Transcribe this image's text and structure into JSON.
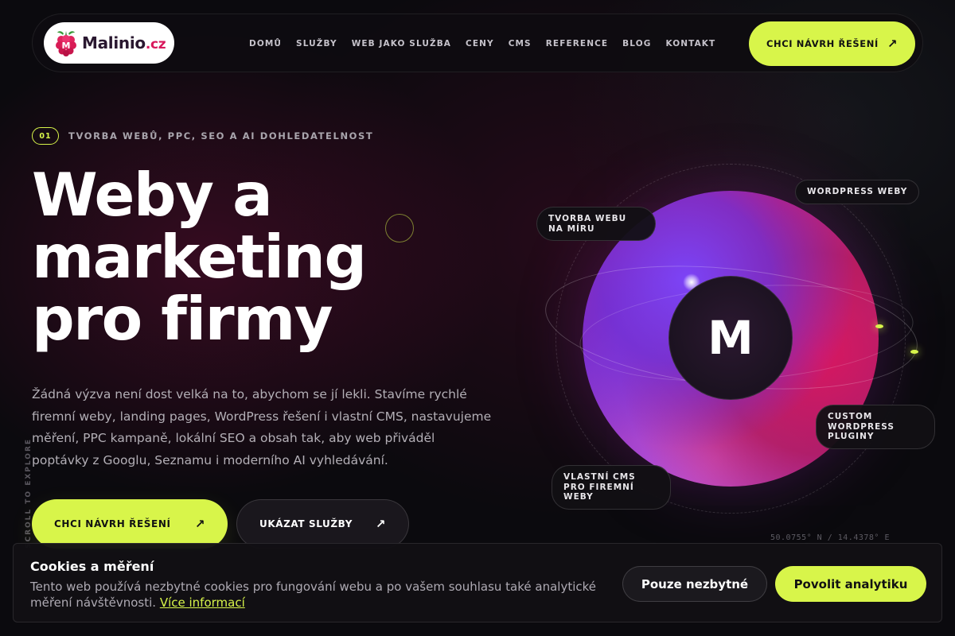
{
  "brand": {
    "name": "Malinio",
    "tld": ".cz",
    "accent": "#d8f54a",
    "logo_icon": "raspberry-icon"
  },
  "nav": {
    "items": [
      "DOMŮ",
      "SLUŽBY",
      "WEB JAKO SLUŽBA",
      "CENY",
      "CMS",
      "REFERENCE",
      "BLOG",
      "KONTAKT"
    ],
    "cta_label": "CHCI NÁVRH ŘEŠENÍ",
    "cta_icon": "arrow-up-right-icon"
  },
  "hero": {
    "eyebrow_number": "01",
    "eyebrow_text": "TVORBA WEBŮ, PPC, SEO A AI DOHLEDATELNOST",
    "title_lines": [
      "Weby a",
      "marketing",
      "pro firmy"
    ],
    "description": "Žádná výzva není dost velká na to, abychom se jí lekli. Stavíme rychlé firemní weby, landing pages, WordPress řešení i vlastní CMS, nastavujeme měření, PPC kampaně, lokální SEO a obsah tak, aby web přiváděl poptávky z Googlu, Seznamu i moderního AI vyhledávání.",
    "primary_button": "CHCI NÁVRH ŘEŠENÍ",
    "secondary_button": "UKÁZAT SLUŽBY",
    "scroll_label": "SCROLL TO EXPLORE"
  },
  "orb": {
    "core_letter": "M",
    "chips": {
      "custom_web": "TVORBA WEBU NA MÍRU",
      "wordpress": "WORDPRESS WEBY",
      "plugins": "CUSTOM WORDPRESS PLUGINY",
      "cms": "VLASTNÍ CMS PRO FIREMNÍ WEBY"
    },
    "coordinates": "50.0755° N / 14.4378° E"
  },
  "cookie": {
    "title": "Cookies a měření",
    "text": "Tento web používá nezbytné cookies pro fungování webu a po vašem souhlasu také analytické měření návštěvnosti.",
    "link_text": "Více informací",
    "necessary_button": "Pouze nezbytné",
    "analytics_button": "Povolit analytiku"
  }
}
